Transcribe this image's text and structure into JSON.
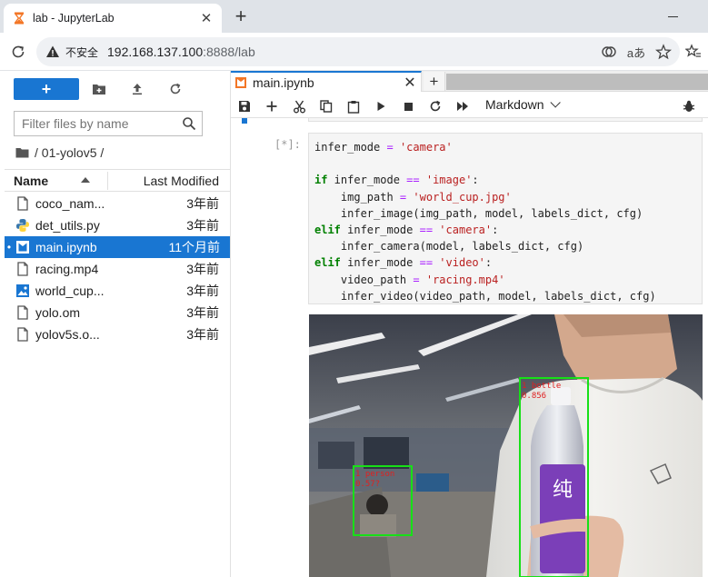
{
  "browser": {
    "tab_title": "lab - JupyterLab",
    "security_label": "不安全",
    "url_host": "192.168.137.100",
    "url_path": ":8888/lab"
  },
  "filebrowser": {
    "filter_placeholder": "Filter files by name",
    "breadcrumb": "/ 01-yolov5 /",
    "col_name": "Name",
    "col_modified": "Last Modified",
    "files": [
      {
        "name": "coco_nam...",
        "modified": "3年前",
        "icon": "file-icon",
        "selected": false
      },
      {
        "name": "det_utils.py",
        "modified": "3年前",
        "icon": "python-icon",
        "selected": false
      },
      {
        "name": "main.ipynb",
        "modified": "11个月前",
        "icon": "notebook-icon",
        "selected": true
      },
      {
        "name": "racing.mp4",
        "modified": "3年前",
        "icon": "file-icon",
        "selected": false
      },
      {
        "name": "world_cup...",
        "modified": "3年前",
        "icon": "image-icon",
        "selected": false
      },
      {
        "name": "yolo.om",
        "modified": "3年前",
        "icon": "file-icon",
        "selected": false
      },
      {
        "name": "yolov5s.o...",
        "modified": "3年前",
        "icon": "file-icon",
        "selected": false
      }
    ]
  },
  "notebook": {
    "tab_title": "main.ipynb",
    "cell_type": "Markdown",
    "prompt": "[*]:",
    "code": [
      [
        [
          "n",
          "infer_mode "
        ],
        [
          "op",
          "="
        ],
        [
          "n",
          " "
        ],
        [
          "str",
          "'camera'"
        ]
      ],
      [],
      [
        [
          "kw",
          "if"
        ],
        [
          "n",
          " infer_mode "
        ],
        [
          "op",
          "=="
        ],
        [
          "n",
          " "
        ],
        [
          "str",
          "'image'"
        ],
        [
          "n",
          ":"
        ]
      ],
      [
        [
          "n",
          "    img_path "
        ],
        [
          "op",
          "="
        ],
        [
          "n",
          " "
        ],
        [
          "str",
          "'world_cup.jpg'"
        ]
      ],
      [
        [
          "n",
          "    infer_image(img_path, model, labels_dict, cfg)"
        ]
      ],
      [
        [
          "kw",
          "elif"
        ],
        [
          "n",
          " infer_mode "
        ],
        [
          "op",
          "=="
        ],
        [
          "n",
          " "
        ],
        [
          "str",
          "'camera'"
        ],
        [
          "n",
          ":"
        ]
      ],
      [
        [
          "n",
          "    infer_camera(model, labels_dict, cfg)"
        ]
      ],
      [
        [
          "kw",
          "elif"
        ],
        [
          "n",
          " infer_mode "
        ],
        [
          "op",
          "=="
        ],
        [
          "n",
          " "
        ],
        [
          "str",
          "'video'"
        ],
        [
          "n",
          ":"
        ]
      ],
      [
        [
          "n",
          "    video_path "
        ],
        [
          "op",
          "="
        ],
        [
          "n",
          " "
        ],
        [
          "str",
          "'racing.mp4'"
        ]
      ],
      [
        [
          "n",
          "    infer_video(video_path, model, labels_dict, cfg)"
        ]
      ]
    ],
    "detections": [
      {
        "label": "1 bottle",
        "score": "0.856"
      },
      {
        "label": "1 person",
        "score": "0.57?"
      }
    ],
    "bottle_text": "纯"
  }
}
